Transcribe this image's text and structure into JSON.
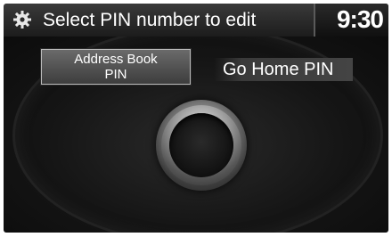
{
  "header": {
    "icon": "gear-icon",
    "title": "Select PIN number to edit",
    "clock": "9:30"
  },
  "options": {
    "address_book_line1": "Address Book",
    "address_book_line2": "PIN",
    "go_home": "Go Home PIN"
  },
  "colors": {
    "header_bg": "#2b2b2b",
    "panel_bg": "#141414",
    "button_bg": "#555555",
    "text": "#ffffff"
  }
}
